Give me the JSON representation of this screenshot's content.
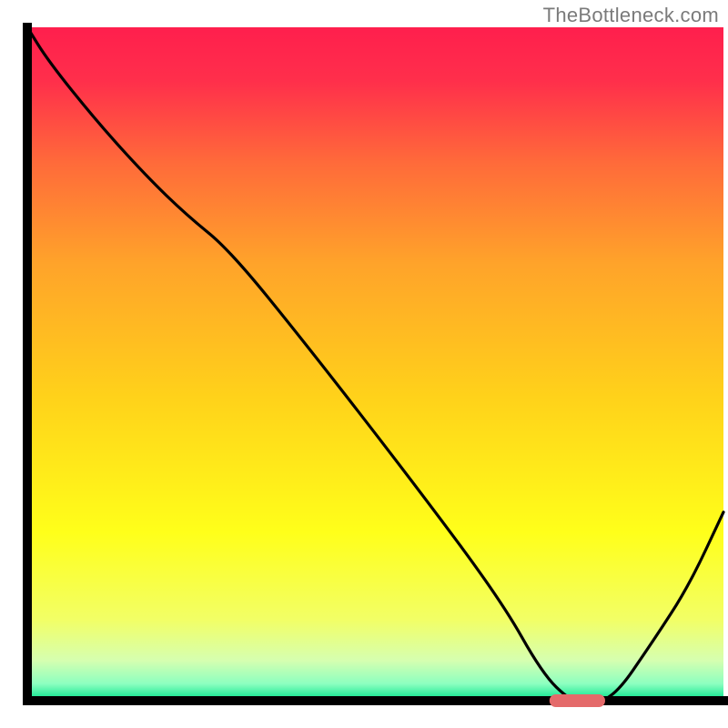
{
  "source": {
    "label": "TheBottleneck.com"
  },
  "chart_data": {
    "type": "line",
    "title": "",
    "xlabel": "",
    "ylabel": "",
    "xlim": [
      0,
      100
    ],
    "ylim": [
      0,
      100
    ],
    "background_gradient": {
      "stops": [
        {
          "offset": 0.0,
          "color": "#ff1f4d"
        },
        {
          "offset": 0.08,
          "color": "#ff2f4b"
        },
        {
          "offset": 0.2,
          "color": "#ff6a3a"
        },
        {
          "offset": 0.35,
          "color": "#ffa32a"
        },
        {
          "offset": 0.55,
          "color": "#ffd21a"
        },
        {
          "offset": 0.75,
          "color": "#ffff1a"
        },
        {
          "offset": 0.88,
          "color": "#f2ff66"
        },
        {
          "offset": 0.94,
          "color": "#d6ffb0"
        },
        {
          "offset": 0.975,
          "color": "#8cffc0"
        },
        {
          "offset": 1.0,
          "color": "#00e38a"
        }
      ]
    },
    "series": [
      {
        "name": "bottleneck-curve",
        "x": [
          0,
          3,
          10,
          17,
          23,
          29,
          40,
          55,
          68,
          74,
          78,
          80,
          84,
          90,
          95,
          100
        ],
        "y": [
          100,
          95,
          86,
          78,
          72,
          67,
          53,
          33,
          15,
          4,
          0,
          0,
          0,
          9,
          17,
          28
        ]
      }
    ],
    "marker": {
      "name": "optimal-range",
      "x_center": 79,
      "y": 0,
      "width": 8,
      "color": "#e46a6a"
    },
    "axes": {
      "left": {
        "x": 3.75
      },
      "bottom": {
        "y": 0.0
      }
    },
    "grid": false,
    "legend": false
  }
}
